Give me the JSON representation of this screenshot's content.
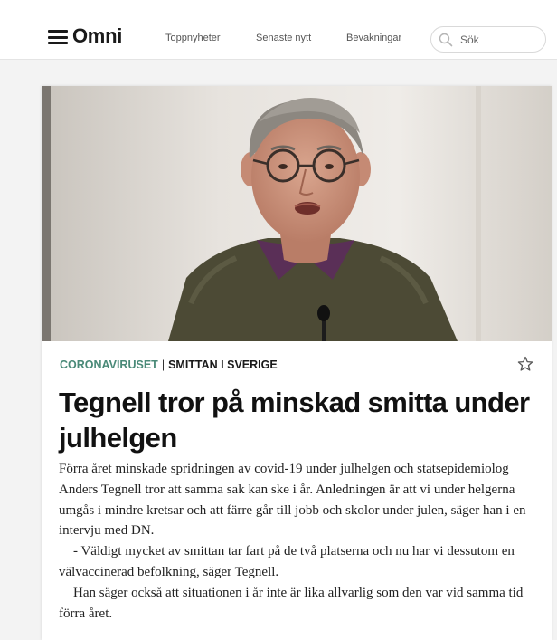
{
  "header": {
    "logo": "Omni",
    "nav": [
      {
        "label": "Toppnyheter"
      },
      {
        "label": "Senaste nytt"
      },
      {
        "label": "Bevakningar"
      }
    ],
    "search": {
      "placeholder": "Sök",
      "value": ""
    }
  },
  "article": {
    "category": "CORONAVIRUSET",
    "separator": "|",
    "subcategory": "SMITTAN I SVERIGE",
    "headline": "Tegnell tror på minskad smitta under julhelgen",
    "paragraphs": [
      "Förra året minskade spridningen av covid-19 under julhelgen och statsepidemiolog Anders Tegnell tror att samma sak kan ske i år. Anledningen är att vi under helgerna umgås i mindre kretsar och att färre går till jobb och skolor under julen, säger han i en intervju med DN.",
      "- Väldigt mycket av smittan tar fart på de två platserna och nu har vi dessutom en välvaccinerad befolkning, säger Tegnell.",
      "Han säger också att situationen i år inte är lika allvarlig som den var vid samma tid förra året."
    ]
  },
  "colors": {
    "accent": "#4a8a78",
    "headline": "#111111",
    "background": "#f3f3f3"
  },
  "icons": [
    "menu-icon",
    "search-icon",
    "star-icon"
  ]
}
